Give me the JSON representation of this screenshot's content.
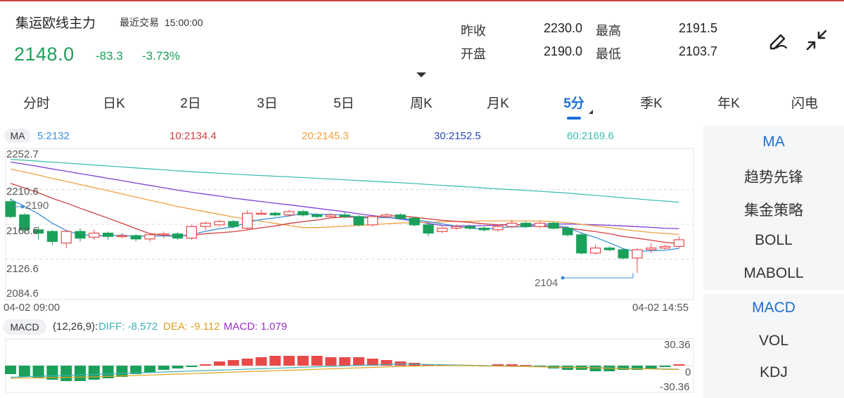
{
  "header": {
    "title": "集运欧线主力",
    "last_trade_label": "最近交易",
    "last_trade_time": "15:00:00",
    "price": "2148.0",
    "change": "-83.3",
    "change_pct": "-3.73%"
  },
  "stats": {
    "prev_close_label": "昨收",
    "prev_close": "2230.0",
    "high_label": "最高",
    "high": "2191.5",
    "open_label": "开盘",
    "open": "2190.0",
    "low_label": "最低",
    "low": "2103.7"
  },
  "icons": {
    "draw": "pen-draw-icon",
    "collapse": "collapse-arrows-icon",
    "expand": "chevron-down-icon"
  },
  "tabs": [
    "分时",
    "日K",
    "2日",
    "3日",
    "5日",
    "周K",
    "月K",
    "5分",
    "季K",
    "年K",
    "闪电"
  ],
  "active_tab": "5分",
  "ma_bar": {
    "label": "MA",
    "ma5": "5:2132",
    "ma10": "10:2134.4",
    "ma20": "20:2145.3",
    "ma30": "30:2152.5",
    "ma60": "60:2169.6"
  },
  "indicators": {
    "main": [
      "MA",
      "趋势先锋",
      "集金策略",
      "BOLL",
      "MABOLL"
    ],
    "sub": [
      "MACD",
      "VOL",
      "KDJ"
    ]
  },
  "colors": {
    "up": "#e84a4a",
    "down": "#1aa05a",
    "ma5": "#3a8fd8",
    "ma10": "#d04040",
    "ma20": "#f0a040",
    "ma30": "#8040d8",
    "ma60": "#40c0b0",
    "active": "#1c6fd6"
  },
  "chart_data": {
    "type": "candlestick",
    "y_ticks": [
      "2252.7",
      "2210.6",
      "2168.6",
      "2126.6",
      "2084.6"
    ],
    "ylim": [
      2084.6,
      2252.7
    ],
    "x_start": "04-02 09:00",
    "x_end": "04-02 14:55",
    "high_marker": "2190",
    "low_marker": "2104",
    "candles": [
      [
        2196,
        2178,
        2200,
        2176
      ],
      [
        2180,
        2162,
        2182,
        2158
      ],
      [
        2162,
        2158,
        2166,
        2150
      ],
      [
        2160,
        2148,
        2162,
        2144
      ],
      [
        2146,
        2160,
        2162,
        2140
      ],
      [
        2160,
        2152,
        2164,
        2148
      ],
      [
        2153,
        2158,
        2162,
        2150
      ],
      [
        2158,
        2154,
        2160,
        2150
      ],
      [
        2154,
        2155,
        2158,
        2152
      ],
      [
        2155,
        2151,
        2157,
        2148
      ],
      [
        2151,
        2156,
        2158,
        2148
      ],
      [
        2156,
        2157,
        2160,
        2152
      ],
      [
        2157,
        2152,
        2159,
        2150
      ],
      [
        2152,
        2166,
        2168,
        2150
      ],
      [
        2166,
        2170,
        2172,
        2162
      ],
      [
        2168,
        2172,
        2174,
        2166
      ],
      [
        2172,
        2166,
        2174,
        2164
      ],
      [
        2164,
        2182,
        2186,
        2162
      ],
      [
        2182,
        2182,
        2186,
        2180
      ],
      [
        2182,
        2180,
        2184,
        2178
      ],
      [
        2180,
        2184,
        2186,
        2178
      ],
      [
        2184,
        2180,
        2186,
        2178
      ],
      [
        2180,
        2178,
        2182,
        2176
      ],
      [
        2178,
        2180,
        2182,
        2176
      ],
      [
        2180,
        2178,
        2184,
        2176
      ],
      [
        2178,
        2168,
        2180,
        2166
      ],
      [
        2168,
        2178,
        2180,
        2166
      ],
      [
        2178,
        2180,
        2182,
        2176
      ],
      [
        2180,
        2176,
        2182,
        2174
      ],
      [
        2176,
        2168,
        2178,
        2166
      ],
      [
        2168,
        2158,
        2170,
        2154
      ],
      [
        2160,
        2164,
        2166,
        2158
      ],
      [
        2164,
        2166,
        2168,
        2162
      ],
      [
        2166,
        2164,
        2168,
        2162
      ],
      [
        2164,
        2162,
        2166,
        2160
      ],
      [
        2162,
        2166,
        2168,
        2160
      ],
      [
        2166,
        2170,
        2174,
        2164
      ],
      [
        2170,
        2166,
        2172,
        2164
      ],
      [
        2166,
        2170,
        2172,
        2164
      ],
      [
        2170,
        2164,
        2172,
        2162
      ],
      [
        2164,
        2156,
        2166,
        2154
      ],
      [
        2156,
        2134,
        2158,
        2132
      ],
      [
        2134,
        2140,
        2144,
        2132
      ],
      [
        2140,
        2138,
        2142,
        2136
      ],
      [
        2138,
        2128,
        2140,
        2126
      ],
      [
        2128,
        2138,
        2140,
        2110
      ],
      [
        2138,
        2140,
        2146,
        2134
      ],
      [
        2140,
        2142,
        2144,
        2138
      ],
      [
        2142,
        2150,
        2154,
        2140
      ]
    ],
    "macd_label": "MACD",
    "macd_params": "(12,26,9):",
    "diff": "DIFF: -8.572",
    "dea": "DEA: -9.112",
    "macd": "MACD: 1.079",
    "macd_ticks": [
      "30.36",
      "0",
      "-30.36"
    ],
    "macd_hist": [
      -6,
      -8,
      -9,
      -10,
      -11,
      -11,
      -10,
      -9,
      -8,
      -6,
      -5,
      -3,
      -2,
      -1,
      1,
      3,
      4,
      5,
      6,
      7,
      7,
      7,
      7,
      6,
      6,
      6,
      5,
      4,
      3,
      2,
      1,
      0.5,
      0.5,
      0.2,
      -0.2,
      1,
      1,
      0.5,
      -0.5,
      -2,
      -3,
      -3,
      -4,
      -4,
      -3,
      -3,
      -2,
      -1,
      1
    ]
  }
}
